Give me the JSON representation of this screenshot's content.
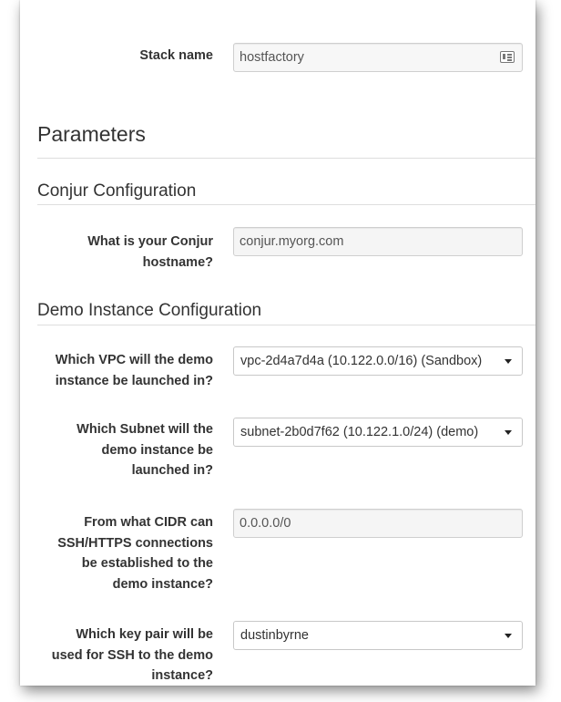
{
  "stack": {
    "label": "Stack name",
    "value": "hostfactory"
  },
  "parameters_heading": "Parameters",
  "conjur_section": {
    "heading": "Conjur Configuration",
    "hostname_label_line1": "What is your Conjur",
    "hostname_label_line2": "hostname?",
    "hostname_value": "conjur.myorg.com"
  },
  "demo_section": {
    "heading": "Demo Instance Configuration",
    "vpc_label_line1": "Which VPC will the demo",
    "vpc_label_line2": "instance be launched in?",
    "vpc_value": "vpc-2d4a7d4a (10.122.0.0/16) (Sandbox)",
    "subnet_label_line1": "Which Subnet will the",
    "subnet_label_line2": "demo instance be",
    "subnet_label_line3": "launched in?",
    "subnet_value": "subnet-2b0d7f62 (10.122.1.0/24) (demo)",
    "cidr_label_line1": "From what CIDR can",
    "cidr_label_line2": "SSH/HTTPS connections",
    "cidr_label_line3": "be established to the",
    "cidr_label_line4": "demo instance?",
    "cidr_value": "0.0.0.0/0",
    "keypair_label_line1": "Which key pair will be",
    "keypair_label_line2": "used for SSH to the demo",
    "keypair_label_line3": "instance?",
    "keypair_value": "dustinbyrne"
  },
  "icons": {
    "stack_field_icon": "contact-card-icon",
    "dropdown_icon": "caret-down-icon"
  }
}
